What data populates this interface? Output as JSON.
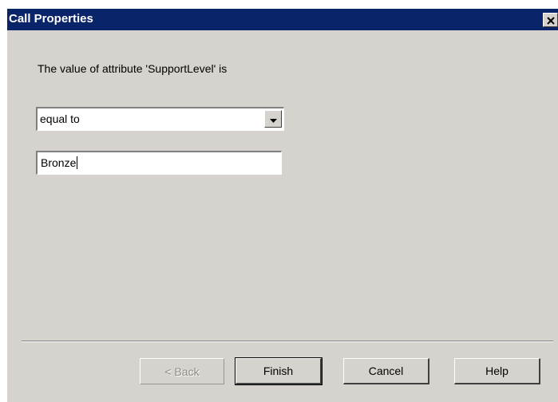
{
  "window": {
    "title": "Call Properties",
    "close_label": "×"
  },
  "content": {
    "prompt": "The value of attribute 'SupportLevel' is",
    "operator_selected": "equal to",
    "value_input": "Bronze"
  },
  "buttons": {
    "back": "< Back",
    "finish": "Finish",
    "cancel": "Cancel",
    "help": "Help"
  },
  "icons": {
    "close": "close-icon",
    "dropdown": "chevron-down-icon"
  },
  "colors": {
    "title_bar": "#0a246a",
    "dialog_face": "#d6d3ce"
  }
}
